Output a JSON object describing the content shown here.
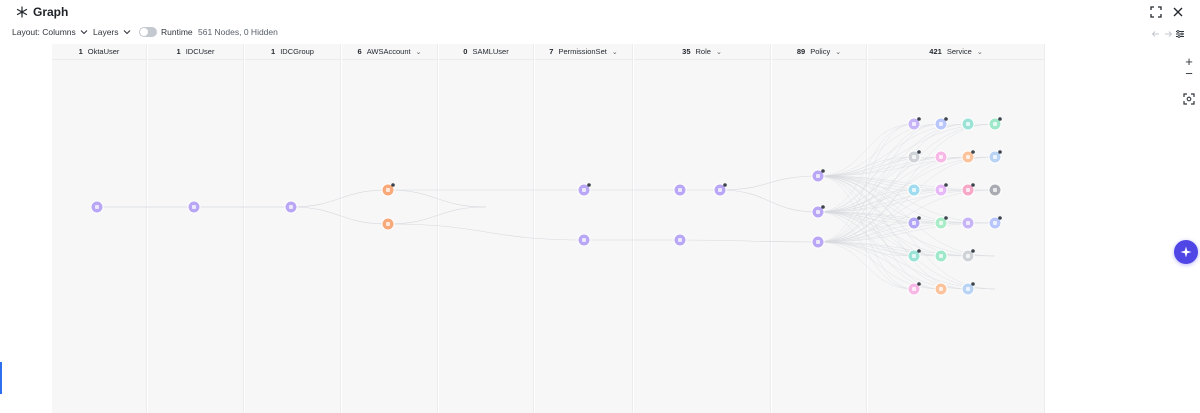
{
  "window": {
    "title": "Graph",
    "icons": {
      "logo": "graph-logo-icon",
      "fullscreen": "fullscreen-icon",
      "close": "close-icon"
    }
  },
  "toolbar": {
    "layout_label": "Layout: Columns",
    "layers_label": "Layers",
    "runtime_label": "Runtime",
    "runtime_on": false,
    "stats": "561 Nodes, 0 Hidden"
  },
  "columns": [
    {
      "count": "1",
      "name": "OktaUser",
      "has_dropdown": false
    },
    {
      "count": "1",
      "name": "IDCUser",
      "has_dropdown": false
    },
    {
      "count": "1",
      "name": "IDCGroup",
      "has_dropdown": false
    },
    {
      "count": "6",
      "name": "AWSAccount",
      "has_dropdown": true
    },
    {
      "count": "0",
      "name": "SAMLUser",
      "has_dropdown": false
    },
    {
      "count": "7",
      "name": "PermissionSet",
      "has_dropdown": true
    },
    {
      "count": "35",
      "name": "Role",
      "has_dropdown": true
    },
    {
      "count": "89",
      "name": "Policy",
      "has_dropdown": true
    },
    {
      "count": "421",
      "name": "Service",
      "has_dropdown": true
    }
  ],
  "colors": {
    "user": "#b9a7f5",
    "account": "#f8a97a",
    "service_grey": "#a9adb3",
    "accent": "#4f46e5",
    "edge": "#d6d8dc"
  },
  "controls": {
    "zoom_in": "+",
    "zoom_out": "−",
    "fit": "fit-view-icon",
    "assistant": "sparkle-icon"
  }
}
